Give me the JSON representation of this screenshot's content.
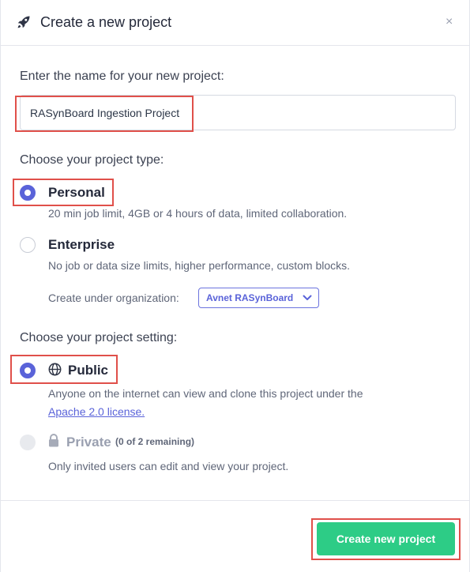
{
  "header": {
    "title": "Create a new project",
    "close_glyph": "×",
    "icon": "rocket-icon"
  },
  "name_section": {
    "label": "Enter the name for your new project:",
    "value": "RASynBoard Ingestion Project"
  },
  "type_section": {
    "label": "Choose your project type:",
    "options": [
      {
        "title": "Personal",
        "description": "20 min job limit, 4GB or 4 hours of data, limited collaboration.",
        "selected": true
      },
      {
        "title": "Enterprise",
        "description": "No job or data size limits, higher performance, custom blocks.",
        "selected": false
      }
    ],
    "org_label": "Create under organization:",
    "org_value": "Avnet RASynBoard"
  },
  "setting_section": {
    "label": "Choose your project setting:",
    "public": {
      "title": "Public",
      "description": "Anyone on the internet can view and clone this project under the",
      "link": "Apache 2.0 license.",
      "selected": true,
      "icon": "globe-icon"
    },
    "private": {
      "title": "Private",
      "remaining": "(0 of 2 remaining)",
      "description": "Only invited users can edit and view your project.",
      "disabled": true,
      "icon": "lock-icon"
    }
  },
  "footer": {
    "create_label": "Create new project"
  },
  "colors": {
    "accent": "#5a63d9",
    "primary_button": "#2dcc86",
    "highlight": "#e0504a"
  }
}
